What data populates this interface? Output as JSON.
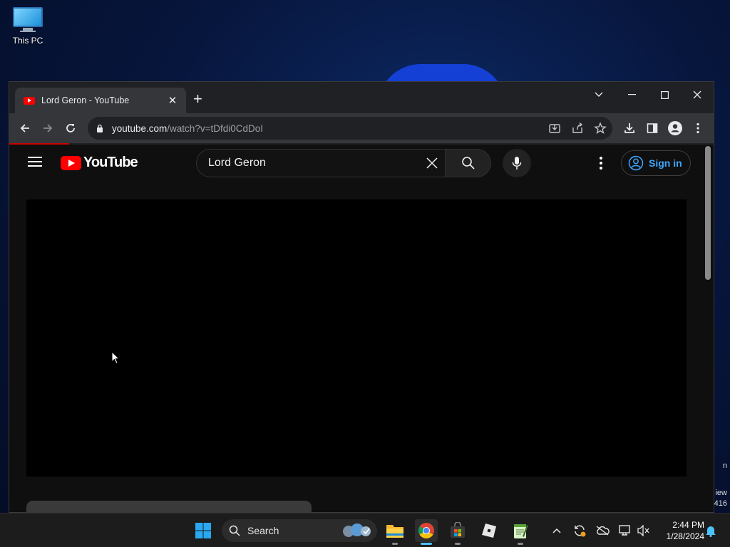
{
  "desktop": {
    "icon_label": "This PC",
    "side_text": [
      "n",
      "iew",
      "416"
    ]
  },
  "browser": {
    "tab_title": "Lord Geron - YouTube",
    "tab_close": "✕",
    "new_tab": "+",
    "url_host": "youtube.com",
    "url_path": "/watch?v=tDfdi0CdDoI",
    "window_controls": {
      "tab_search": "⌄",
      "minimize": "—",
      "maximize": "☐",
      "close": "✕"
    }
  },
  "youtube": {
    "logo_text": "YouTube",
    "search_query": "Lord Geron",
    "sign_in_label": "Sign in"
  },
  "taskbar": {
    "search_label": "Search",
    "time": "2:44 PM",
    "date": "1/28/2024"
  },
  "colors": {
    "youtube_red": "#ff0000",
    "signin_blue": "#3ea6ff",
    "active_indicator": "#4cc2ff"
  }
}
